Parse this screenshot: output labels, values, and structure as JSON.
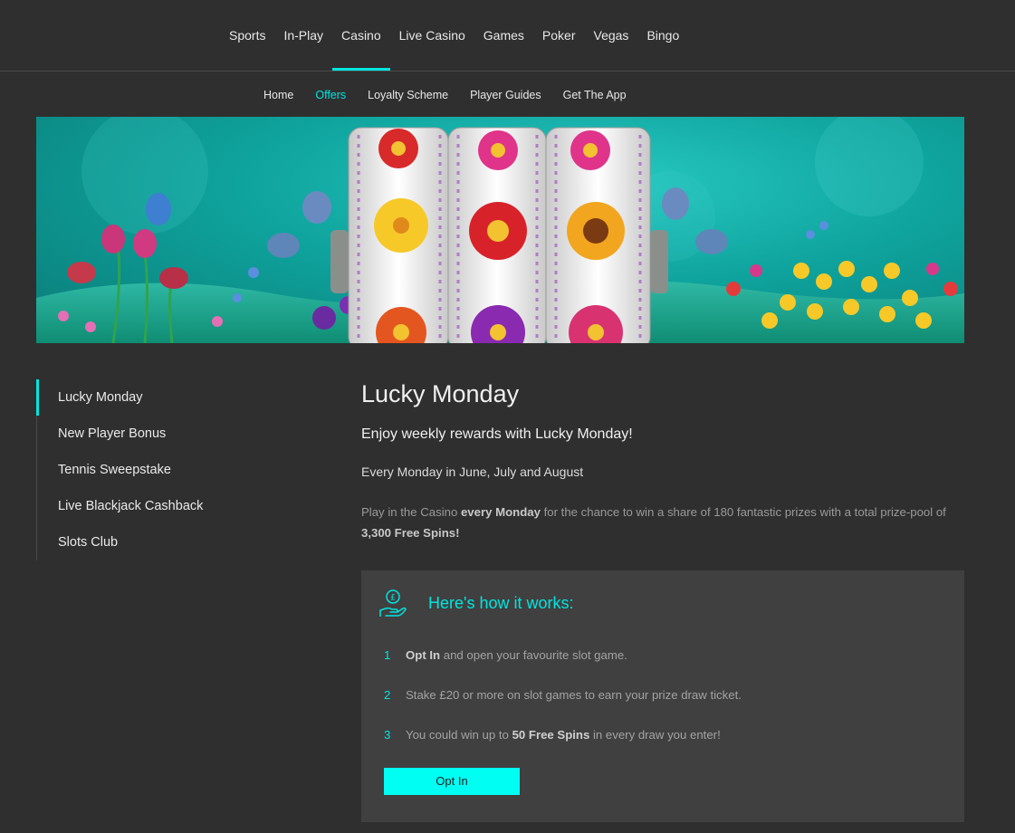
{
  "top_nav": {
    "items": [
      {
        "label": "Sports"
      },
      {
        "label": "In-Play"
      },
      {
        "label": "Casino",
        "active": true
      },
      {
        "label": "Live Casino"
      },
      {
        "label": "Games"
      },
      {
        "label": "Poker"
      },
      {
        "label": "Vegas"
      },
      {
        "label": "Bingo"
      }
    ]
  },
  "sub_nav": {
    "items": [
      {
        "label": "Home"
      },
      {
        "label": "Offers",
        "active": true
      },
      {
        "label": "Loyalty Scheme"
      },
      {
        "label": "Player Guides"
      },
      {
        "label": "Get The App"
      }
    ]
  },
  "side_menu": {
    "items": [
      {
        "label": "Lucky Monday",
        "active": true
      },
      {
        "label": "New Player Bonus"
      },
      {
        "label": "Tennis Sweepstake"
      },
      {
        "label": "Live Blackjack Cashback"
      },
      {
        "label": "Slots Club"
      }
    ]
  },
  "promo": {
    "title": "Lucky Monday",
    "lead": "Enjoy weekly rewards with Lucky Monday!",
    "dates": "Every Monday in June, July and August",
    "desc": {
      "p1": "Play in the Casino ",
      "b1": "every Monday",
      "p2": " for the chance to win a share of 180 fantastic prizes with a total prize-pool of ",
      "b2": "3,300 Free Spins!"
    }
  },
  "how_it_works": {
    "icon": "hand-coin-icon",
    "title": "Here's how it works:",
    "steps": [
      {
        "num": "1",
        "bold": "Opt In",
        "text": " and open your favourite slot game."
      },
      {
        "num": "2",
        "text": "Stake £20 or more on slot games to earn your prize draw ticket."
      },
      {
        "num": "3",
        "text_before": "You could win up to ",
        "bold": "50 Free Spins",
        "text_after": " in every draw you enter!"
      }
    ],
    "button_label": "Opt In"
  },
  "colors": {
    "accent": "#00e5e0",
    "background": "#2f2f2f",
    "panel": "#404040",
    "button": "#00fff2"
  }
}
